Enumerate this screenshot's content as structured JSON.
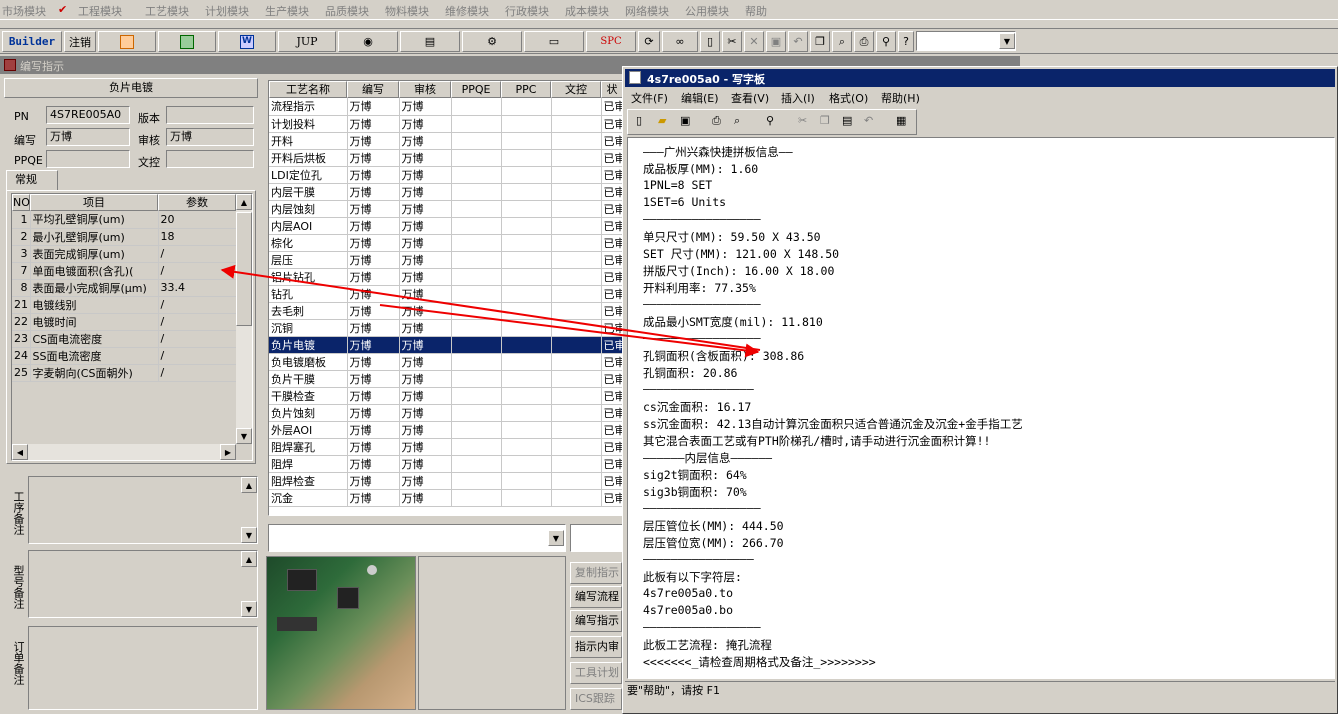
{
  "menus": [
    "市场模块",
    "工程模块",
    "工艺模块",
    "计划模块",
    "生产模块",
    "品质模块",
    "物料模块",
    "维修模块",
    "行政模块",
    "成本模块",
    "网络模块",
    "公用模块",
    "帮助"
  ],
  "toolbar": {
    "builder": "Builder",
    "logout": "注销",
    "jup": "JUP",
    "spc": "SPC"
  },
  "inner_window": {
    "title": "编写指示"
  },
  "panel": {
    "heading": "负片电镀",
    "pn_label": "PN",
    "pn_value": "4S7RE005A0",
    "version_label": "版本",
    "version_value": "",
    "writer_label": "编写",
    "writer_value": "万博",
    "review_label": "审核",
    "review_value": "万博",
    "ppqe_label": "PPQE",
    "ppqe_value": "",
    "control_label": "文控",
    "control_value": "",
    "tab": "常规"
  },
  "params": {
    "headers": [
      "NO",
      "项目",
      "参数"
    ],
    "rows": [
      {
        "no": "1",
        "item": "平均孔壁铜厚(um)",
        "val": "20"
      },
      {
        "no": "2",
        "item": "最小孔壁铜厚(um)",
        "val": "18"
      },
      {
        "no": "3",
        "item": "表面完成铜厚(um)",
        "val": "/"
      },
      {
        "no": "7",
        "item": "单面电镀面积(含孔)(",
        "val": "/"
      },
      {
        "no": "8",
        "item": "表面最小完成铜厚(μm)",
        "val": "33.4"
      },
      {
        "no": "21",
        "item": "电镀线别",
        "val": "/"
      },
      {
        "no": "22",
        "item": "电镀时间",
        "val": "/"
      },
      {
        "no": "23",
        "item": "CS面电流密度",
        "val": "/"
      },
      {
        "no": "24",
        "item": "SS面电流密度",
        "val": "/"
      },
      {
        "no": "25",
        "item": "字麦朝向(CS面朝外)",
        "val": "/"
      }
    ]
  },
  "notes": {
    "process": "工序备注",
    "model": "型号备注",
    "order": "订单备注"
  },
  "process": {
    "headers": [
      "工艺名称",
      "编写",
      "审核",
      "PPQE",
      "PPC",
      "文控"
    ],
    "status_header": "状",
    "rows": [
      {
        "name": "流程指示",
        "w": "万博",
        "r": "万博",
        "s": "已审"
      },
      {
        "name": "计划投料",
        "w": "万博",
        "r": "万博",
        "s": "已审"
      },
      {
        "name": "开料",
        "w": "万博",
        "r": "万博",
        "s": "已审"
      },
      {
        "name": "开料后烘板",
        "w": "万博",
        "r": "万博",
        "s": "已审"
      },
      {
        "name": "LDI定位孔",
        "w": "万博",
        "r": "万博",
        "s": "已审"
      },
      {
        "name": "内层干膜",
        "w": "万博",
        "r": "万博",
        "s": "已审"
      },
      {
        "name": "内层蚀刻",
        "w": "万博",
        "r": "万博",
        "s": "已审"
      },
      {
        "name": "内层AOI",
        "w": "万博",
        "r": "万博",
        "s": "已审"
      },
      {
        "name": "棕化",
        "w": "万博",
        "r": "万博",
        "s": "已审"
      },
      {
        "name": "层压",
        "w": "万博",
        "r": "万博",
        "s": "已审"
      },
      {
        "name": "铝片钻孔",
        "w": "万博",
        "r": "万博",
        "s": "已审"
      },
      {
        "name": "钻孔",
        "w": "万博",
        "r": "万博",
        "s": "已审"
      },
      {
        "name": "去毛刺",
        "w": "万博",
        "r": "万博",
        "s": "已审"
      },
      {
        "name": "沉铜",
        "w": "万博",
        "r": "万博",
        "s": "已审"
      },
      {
        "name": "负片电镀",
        "w": "万博",
        "r": "万博",
        "s": "已审"
      },
      {
        "name": "负电镀磨板",
        "w": "万博",
        "r": "万博",
        "s": "已审"
      },
      {
        "name": "负片干膜",
        "w": "万博",
        "r": "万博",
        "s": "已审"
      },
      {
        "name": "干膜检查",
        "w": "万博",
        "r": "万博",
        "s": "已审"
      },
      {
        "name": "负片蚀刻",
        "w": "万博",
        "r": "万博",
        "s": "已审"
      },
      {
        "name": "外层AOI",
        "w": "万博",
        "r": "万博",
        "s": "已审"
      },
      {
        "name": "阻焊塞孔",
        "w": "万博",
        "r": "万博",
        "s": "已审"
      },
      {
        "name": "阻焊",
        "w": "万博",
        "r": "万博",
        "s": "已审"
      },
      {
        "name": "阻焊检查",
        "w": "万博",
        "r": "万博",
        "s": "已审"
      },
      {
        "name": "沉金",
        "w": "万博",
        "r": "万博",
        "s": "已审"
      }
    ]
  },
  "side_buttons": [
    "复制指示",
    "编写流程",
    "编写指示",
    "指示内审",
    "工具计划",
    "ICS跟踪"
  ],
  "wordpad": {
    "title": "4s7re005a0 - 写字板",
    "menus": [
      "文件(F)",
      "编辑(E)",
      "查看(V)",
      "插入(I)",
      "格式(O)",
      "帮助(H)"
    ],
    "status": "要\"帮助\"，请按 F1",
    "lines": [
      "———广州兴森快捷拼板信息——",
      "成品板厚(MM): 1.60",
      "1PNL=8 SET",
      "1SET=6 Units",
      "—————————————————",
      "单只尺寸(MM): 59.50 X 43.50",
      "SET 尺寸(MM): 121.00 X 148.50",
      "拼版尺寸(Inch): 16.00 X 18.00",
      "开料利用率: 77.35%",
      "—————————————————",
      "成品最小SMT宽度(mil): 11.810",
      "—————————————————",
      "孔铜面积(含板面积): 308.86",
      "孔铜面积: 20.86",
      "————————————————",
      "cs沉金面积: 16.17",
      "ss沉金面积: 42.13自动计算沉金面积只适合普通沉金及沉金+金手指工艺",
      "其它混合表面工艺或有PTH阶梯孔/槽时,请手动进行沉金面积计算!!",
      "——————内层信息——————",
      "sig2t铜面积: 64%",
      "sig3b铜面积: 70%",
      "—————————————————",
      "层压管位长(MM): 444.50",
      "层压管位宽(MM): 266.70",
      "————————————————",
      "此板有以下字符层:",
      "4s7re005a0.to",
      "4s7re005a0.bo",
      "—————————————————",
      "此板工艺流程: 掩孔流程",
      "<<<<<<<_请检查周期格式及备注_>>>>>>>>"
    ]
  }
}
